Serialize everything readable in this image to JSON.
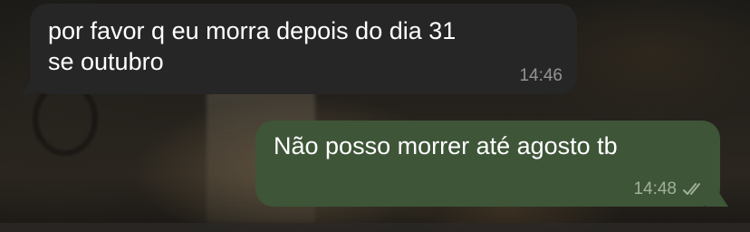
{
  "conversation": {
    "messages": [
      {
        "direction": "incoming",
        "text": "por favor q eu morra depois do dia 31\nse outubro",
        "time": "14:46"
      },
      {
        "direction": "outgoing",
        "text": "Não posso morrer até agosto tb",
        "time": "14:48",
        "status_icon": "double-check-icon"
      }
    ]
  },
  "colors": {
    "incoming_bubble": "#262626",
    "outgoing_bubble": "#3e5538",
    "text": "#ffffff"
  }
}
